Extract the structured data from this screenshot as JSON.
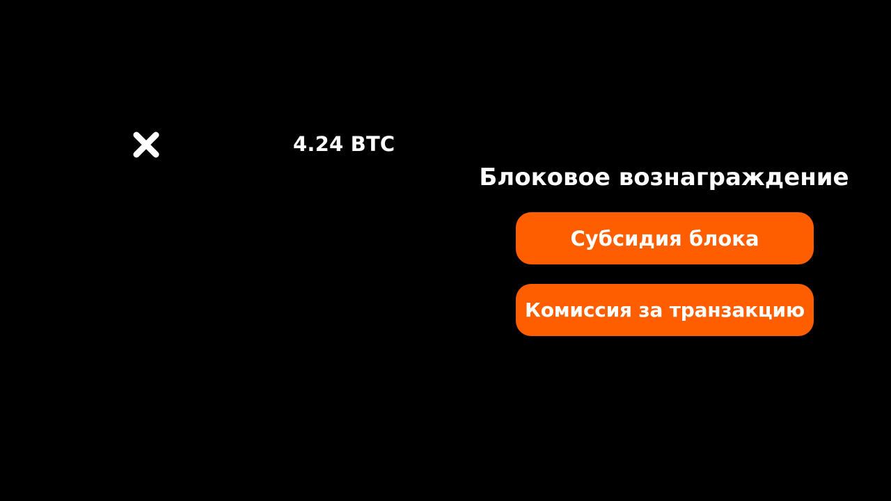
{
  "close": {
    "icon": "close-icon"
  },
  "amount": {
    "value": "4.24 BTC"
  },
  "heading": {
    "text": "Блоковое вознаграждение"
  },
  "options": [
    {
      "label": "Субсидия блока"
    },
    {
      "label": "Комиссия за транзакцию"
    }
  ],
  "colors": {
    "background": "#000000",
    "text": "#ffffff",
    "accent": "#ff5e00"
  }
}
